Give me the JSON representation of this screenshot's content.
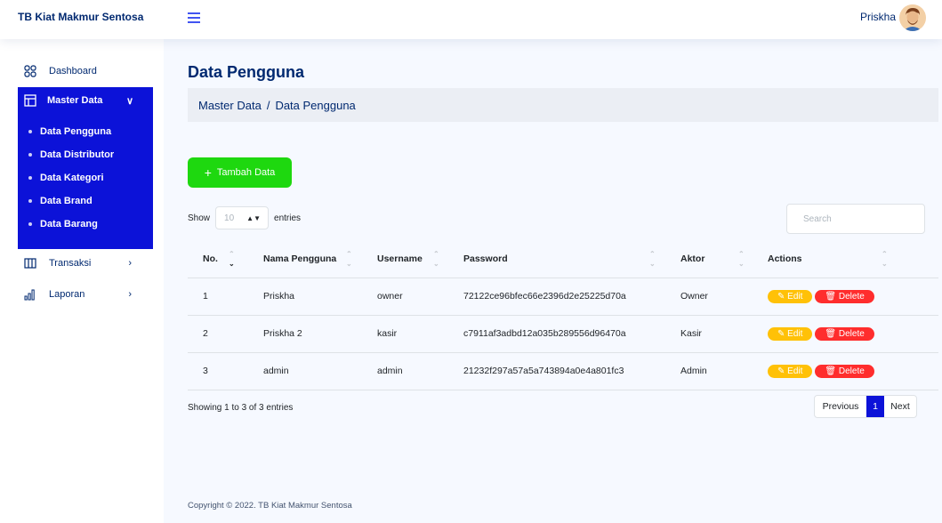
{
  "app": {
    "brand": "TB Kiat Makmur Sentosa",
    "user": "Priskha"
  },
  "sidebar": {
    "dashboard": "Dashboard",
    "master": "Master Data",
    "master_items": [
      "Data Pengguna",
      "Data Distributor",
      "Data Kategori",
      "Data Brand",
      "Data Barang"
    ],
    "transaksi": "Transaksi",
    "laporan": "Laporan",
    "accent": "#0c12d8"
  },
  "page": {
    "title": "Data Pengguna",
    "breadcrumb": [
      "Master Data",
      "/",
      "Data Pengguna"
    ],
    "add_button": "Tambah Data",
    "show_label": "Show",
    "entries_value": "10",
    "entries_label": "entries",
    "search_placeholder": "Search"
  },
  "table": {
    "headers": [
      "No.",
      "Nama Pengguna",
      "Username",
      "Password",
      "Aktor",
      "Actions"
    ],
    "rows": [
      {
        "no": "1",
        "nama": "Priskha",
        "username": "owner",
        "password": "72122ce96bfec66e2396d2e25225d70a",
        "aktor": "Owner"
      },
      {
        "no": "2",
        "nama": "Priskha 2",
        "username": "kasir",
        "password": "c7911af3adbd12a035b289556d96470a",
        "aktor": "Kasir"
      },
      {
        "no": "3",
        "nama": "admin",
        "username": "admin",
        "password": "21232f297a57a5a743894a0e4a801fc3",
        "aktor": "Admin"
      }
    ],
    "edit_label": "Edit",
    "delete_label": "Delete"
  },
  "info": "Showing 1 to 3 of 3 entries",
  "pagination": {
    "prev": "Previous",
    "current": "1",
    "next": "Next"
  },
  "footer": "Copyright © 2022. TB Kiat Makmur Sentosa"
}
